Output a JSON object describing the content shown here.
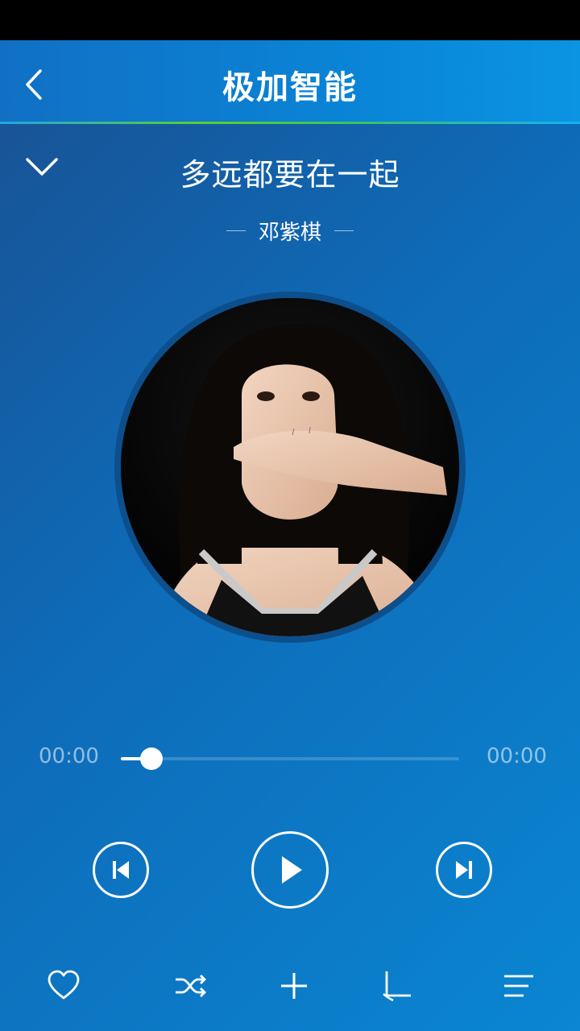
{
  "header": {
    "title": "极加智能",
    "back_icon": "chevron-left-icon"
  },
  "song": {
    "title": "多远都要在一起",
    "artist": "邓紫棋"
  },
  "player": {
    "current_time": "00:00",
    "total_time": "00:00",
    "progress_fraction": 0.09
  },
  "controls": {
    "prev_icon": "skip-previous-icon",
    "play_icon": "play-icon",
    "next_icon": "skip-next-icon"
  },
  "bottom_bar": {
    "items": [
      "heart-icon",
      "shuffle-icon",
      "plus-icon",
      "sleep-timer-icon",
      "playlist-icon"
    ]
  },
  "colors": {
    "accent_line_green": "#5ccf2a",
    "header_blue": "#0a84d6",
    "background_blue": "#0e6bb8"
  }
}
